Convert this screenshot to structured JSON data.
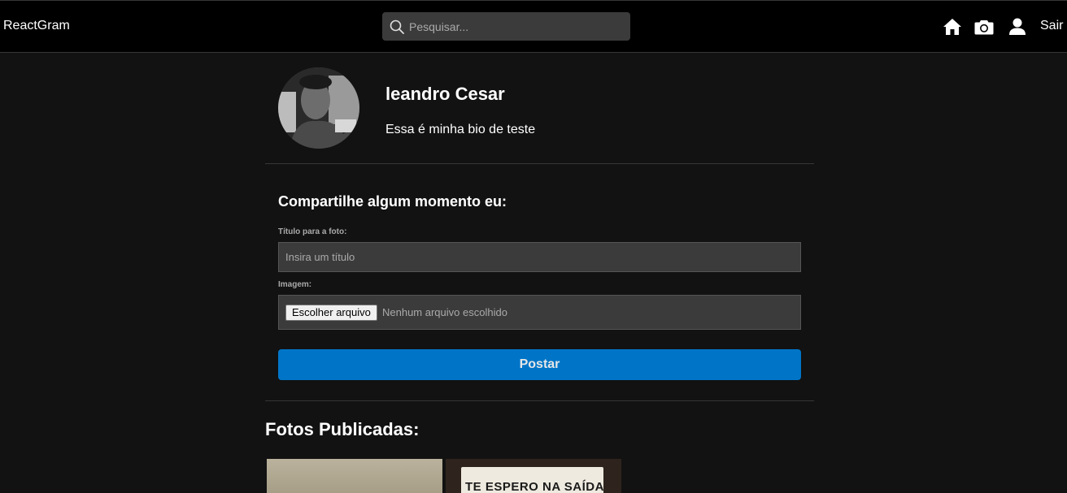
{
  "navbar": {
    "brand": "ReactGram",
    "search_placeholder": "Pesquisar...",
    "icons": [
      "home-icon",
      "camera-icon",
      "user-icon"
    ],
    "logout_label": "Sair"
  },
  "profile": {
    "name": "leandro Cesar",
    "bio": "Essa é minha bio de teste"
  },
  "new_photo": {
    "heading": "Compartilhe algum momento eu:",
    "title_label": "Título para a foto:",
    "title_placeholder": "Insira um título",
    "image_label": "Imagem:",
    "file_button_label": "Escolher arquivo",
    "file_status": "Nenhum arquivo escolhido",
    "submit_label": "Postar"
  },
  "photos": {
    "heading": "Fotos Publicadas:",
    "items": [
      {
        "caption_visible": ""
      },
      {
        "caption_visible": "TE ESPERO NA SAÍDA"
      }
    ]
  },
  "colors": {
    "background": "#121212",
    "navbar": "#000000",
    "input_bg": "#3b3b3b",
    "accent": "#0075c8"
  }
}
